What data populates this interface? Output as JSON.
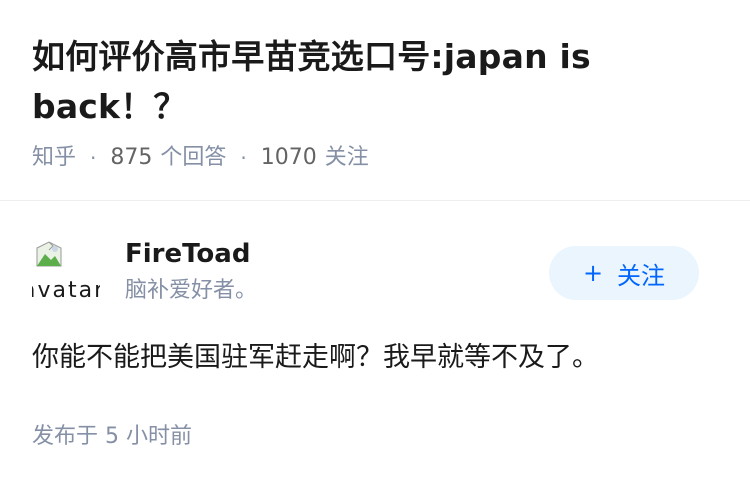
{
  "question": {
    "title": "如何评价高市早苗竞选口号:japan is back！？",
    "source": "知乎",
    "answers_count": "875",
    "answers_label": "个回答",
    "follows_count": "1070",
    "follows_label": "关注"
  },
  "author": {
    "avatar_alt": "avatar",
    "name": "FireToad",
    "bio": "脑补爱好者。",
    "follow_icon": "plus-icon",
    "follow_plus": "+",
    "follow_label": "关注"
  },
  "answer": {
    "content": "你能不能把美国驻军赶走啊？我早就等不及了。",
    "published": "发布于 5 小时前"
  },
  "colors": {
    "title": "#1a1a1a",
    "meta": "#8590a6",
    "accent": "#0066ff",
    "follow_bg": "#ebf5fd"
  }
}
